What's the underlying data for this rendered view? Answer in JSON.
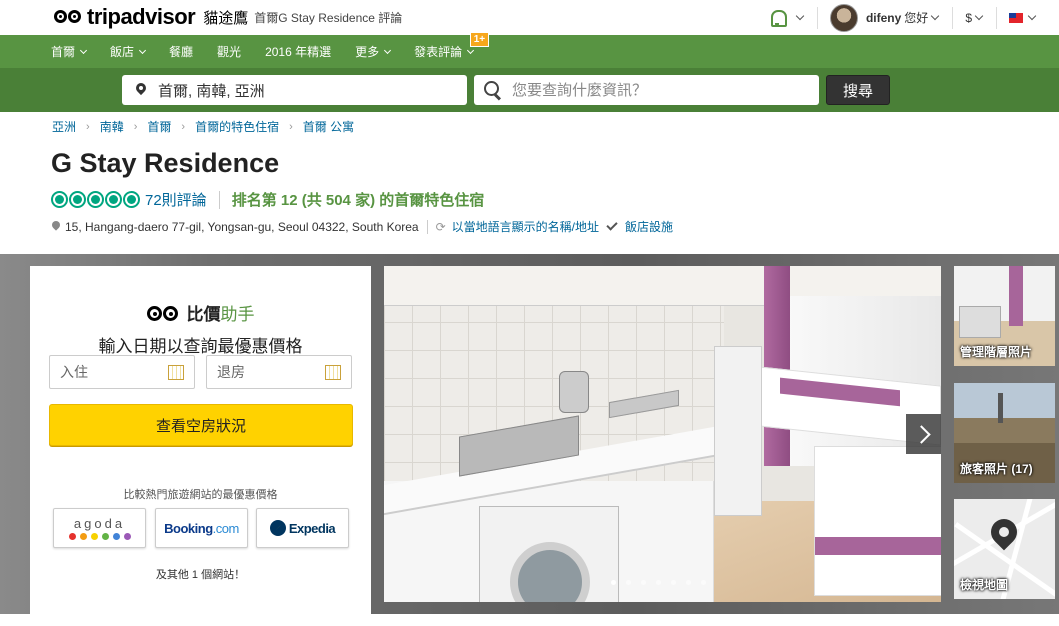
{
  "header": {
    "brand": "tripadvisor",
    "brand_cn": "貓途鷹",
    "page_subtitle": "首爾G Stay Residence 評論",
    "username": "difeny",
    "greeting": "您好",
    "currency": "$"
  },
  "nav": {
    "items": [
      "首爾",
      "飯店",
      "餐廳",
      "觀光",
      "2016 年精選",
      "更多",
      "發表評論"
    ],
    "badge": "1+"
  },
  "search": {
    "location": "首爾, 南韓, 亞洲",
    "query_placeholder": "您要查詢什麼資訊？",
    "button": "搜尋"
  },
  "breadcrumbs": [
    "亞洲",
    "南韓",
    "首爾",
    "首爾的特色住宿",
    "首爾 公寓"
  ],
  "hotel": {
    "name": "G Stay Residence",
    "rating": 5,
    "reviews": "72則評論",
    "rank": "排名第 12 (共 504 家) 的首爾特色住宿",
    "address": "15, Hangang-daero 77-gil, Yongsan-gu, Seoul 04322, South Korea",
    "local_name_link": "以當地語言顯示的名稱/地址",
    "amenities_link": "飯店設施"
  },
  "booking": {
    "title": "比價",
    "title_accent": "助手",
    "subtitle": "輸入日期以查詢最優惠價格",
    "checkin_placeholder": "入住",
    "checkout_placeholder": "退房",
    "cta": "查看空房狀況",
    "compare_text": "比較熱門旅遊網站的最優惠價格",
    "partners": {
      "agoda": "agoda",
      "booking_1": "Booking",
      "booking_2": ".com",
      "expedia": "Expedia"
    },
    "more": "及其他 1 個網站！",
    "agoda_dot_colors": [
      "#e5322d",
      "#f39c12",
      "#f7d100",
      "#62b345",
      "#4183d7",
      "#9b59b6"
    ]
  },
  "gallery": {
    "thumbs": [
      "管理階層照片",
      "旅客照片 (17)",
      "檢視地圖"
    ],
    "dot_count": 7,
    "active_dot": 0
  },
  "colors": {
    "brand_green": "#589442",
    "search_green": "#4a8037",
    "bubble_green": "#00a680",
    "cta_yellow": "#ffd200",
    "link_blue": "#006699"
  }
}
